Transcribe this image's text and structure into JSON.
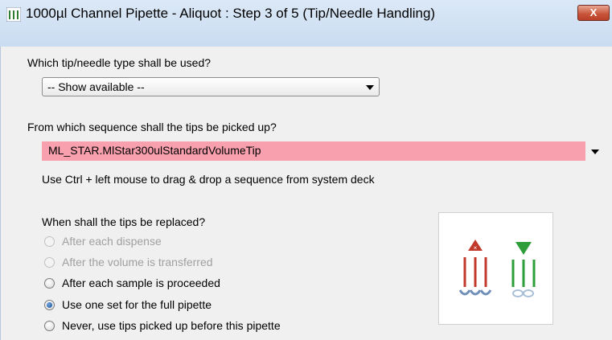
{
  "window": {
    "title": "1000µl Channel Pipette - Aliquot : Step 3 of 5 (Tip/Needle Handling)",
    "close_label": "X"
  },
  "tip_type": {
    "label": "Which tip/needle type shall be used?",
    "selected": "-- Show available --"
  },
  "sequence": {
    "label": "From which sequence shall the tips be picked up?",
    "value": "ML_STAR.MlStar300ulStandardVolumeTip",
    "hint": "Use Ctrl + left mouse to drag & drop a sequence from system deck"
  },
  "replace": {
    "label": "When shall the tips be replaced?",
    "options": [
      {
        "label": "After each dispense",
        "enabled": false,
        "selected": false
      },
      {
        "label": "After the volume is transferred",
        "enabled": false,
        "selected": false
      },
      {
        "label": "After each sample is proceeded",
        "enabled": true,
        "selected": false
      },
      {
        "label": "Use one set for the full pipette",
        "enabled": true,
        "selected": true
      },
      {
        "label": "Never, use tips picked up before this pipette",
        "enabled": true,
        "selected": false
      }
    ]
  },
  "illustration": {
    "icons": [
      "tip-eject-icon",
      "tip-pickup-icon"
    ],
    "colors": {
      "red": "#c0392b",
      "green": "#2e9e3a",
      "tip": "#6f8fb8"
    }
  }
}
